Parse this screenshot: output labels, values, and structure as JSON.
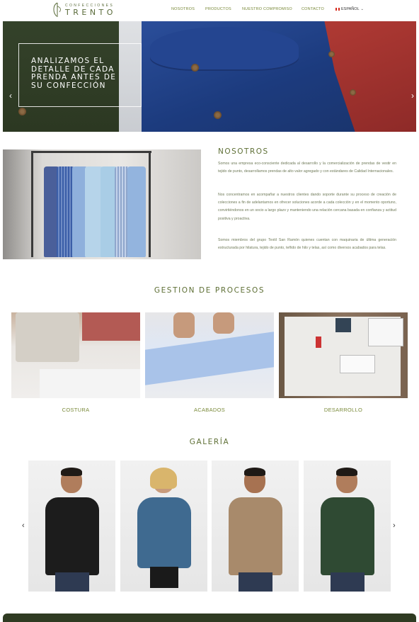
{
  "brand": {
    "top": "CONFECCIONES",
    "name": "TRENTO",
    "color": "#5a6b3a"
  },
  "nav": {
    "items": [
      "NOSOTROS",
      "PRODUCTOS",
      "NUESTRO COMPROMISO",
      "CONTACTO"
    ],
    "language": "ESPAÑOL",
    "language_flag_icon": "peru-flag-icon",
    "chevron_icon": "chevron-down-icon"
  },
  "hero": {
    "text": "ANALIZAMOS EL DETALLE DE CADA PRENDA ANTES DE SU CONFECCIÓN",
    "prev_icon": "chevron-left-icon",
    "next_icon": "chevron-right-icon",
    "prev_glyph": "‹",
    "next_glyph": "›"
  },
  "about": {
    "title": "NOSOTROS",
    "paragraphs": [
      "Somos una empresa eco-consciente dedicada al desarrollo y la comercialización de prendas de vestir en tejido de punto, desarrollamos prendas de alto valor agregado y con estándares de Calidad Internacionales.",
      "Nos concentramos en acompañar a nuestros clientes dando soporte durante su proceso de creación de colecciones a fin de adelantarnos en ofrecer soluciones acorde a cada colección y en el momento oportuno, convirtiéndonos en un socio a largo plazo y manteniendo una relación cercana basada en confianza y actitud positiva y proactiva.",
      "Somos miembros del grupo Textil San Ramón quienes cuentan con maquinaria de última generación estructurada por hilatura, tejido de punto, teñido de hilo y telas, así como diversos acabados para telas."
    ]
  },
  "processes": {
    "title": "GESTION DE PROCESOS",
    "items": [
      {
        "label": "COSTURA"
      },
      {
        "label": "ACABADOS"
      },
      {
        "label": "DESARROLLO"
      }
    ]
  },
  "gallery": {
    "title": "GALERÍA",
    "prev_glyph": "‹",
    "next_glyph": "›"
  },
  "colors": {
    "accent": "#5e6f35",
    "nav": "#7a8a3a",
    "dark_green": "#2f3b22"
  }
}
